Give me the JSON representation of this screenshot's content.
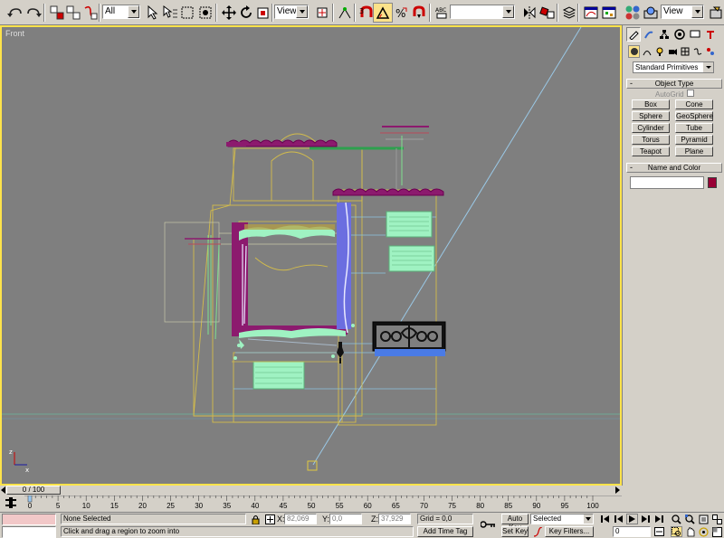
{
  "toolbar": {
    "selection_filter": "All",
    "ref_coord_system": "View",
    "named_selection": "",
    "view_dropdown_right": "View"
  },
  "viewport": {
    "label": "Front"
  },
  "command_panel": {
    "primitive_type": "Standard Primitives",
    "object_type_header": "Object Type",
    "autogrid_label": "AutoGrid",
    "buttons": [
      "Box",
      "Cone",
      "Sphere",
      "GeoSphere",
      "Cylinder",
      "Tube",
      "Torus",
      "Pyramid",
      "Teapot",
      "Plane"
    ],
    "name_color_header": "Name and Color",
    "object_color": "#990036",
    "minus_glyph": "-"
  },
  "time": {
    "slider_label": "0 / 100",
    "ticks": [
      "0",
      "5",
      "10",
      "15",
      "20",
      "25",
      "30",
      "35",
      "40",
      "45",
      "50",
      "55",
      "60",
      "65",
      "70",
      "75",
      "80",
      "85",
      "90",
      "95",
      "100"
    ]
  },
  "status": {
    "selection": "None Selected",
    "prompt": "Click and drag a region to zoom into",
    "x_label": "X:",
    "x_value": "82,069",
    "y_label": "Y:",
    "y_value": "0,0",
    "z_label": "Z:",
    "z_value": "37,929",
    "grid": "Grid = 0,0",
    "add_time_tag": "Add Time Tag",
    "auto_key": "Auto Key",
    "set_key": "Set Key",
    "key_mode": "Selected",
    "key_filters": "Key Filters...",
    "frame": "0"
  },
  "colors": {
    "viewport_bg": "#7f7f7f",
    "viewport_border": "#ffe34a",
    "wire_yellow": "#d8c34a",
    "magenta": "#9b006b",
    "mint": "#9ff2c2",
    "blue": "#6b6ee0"
  }
}
